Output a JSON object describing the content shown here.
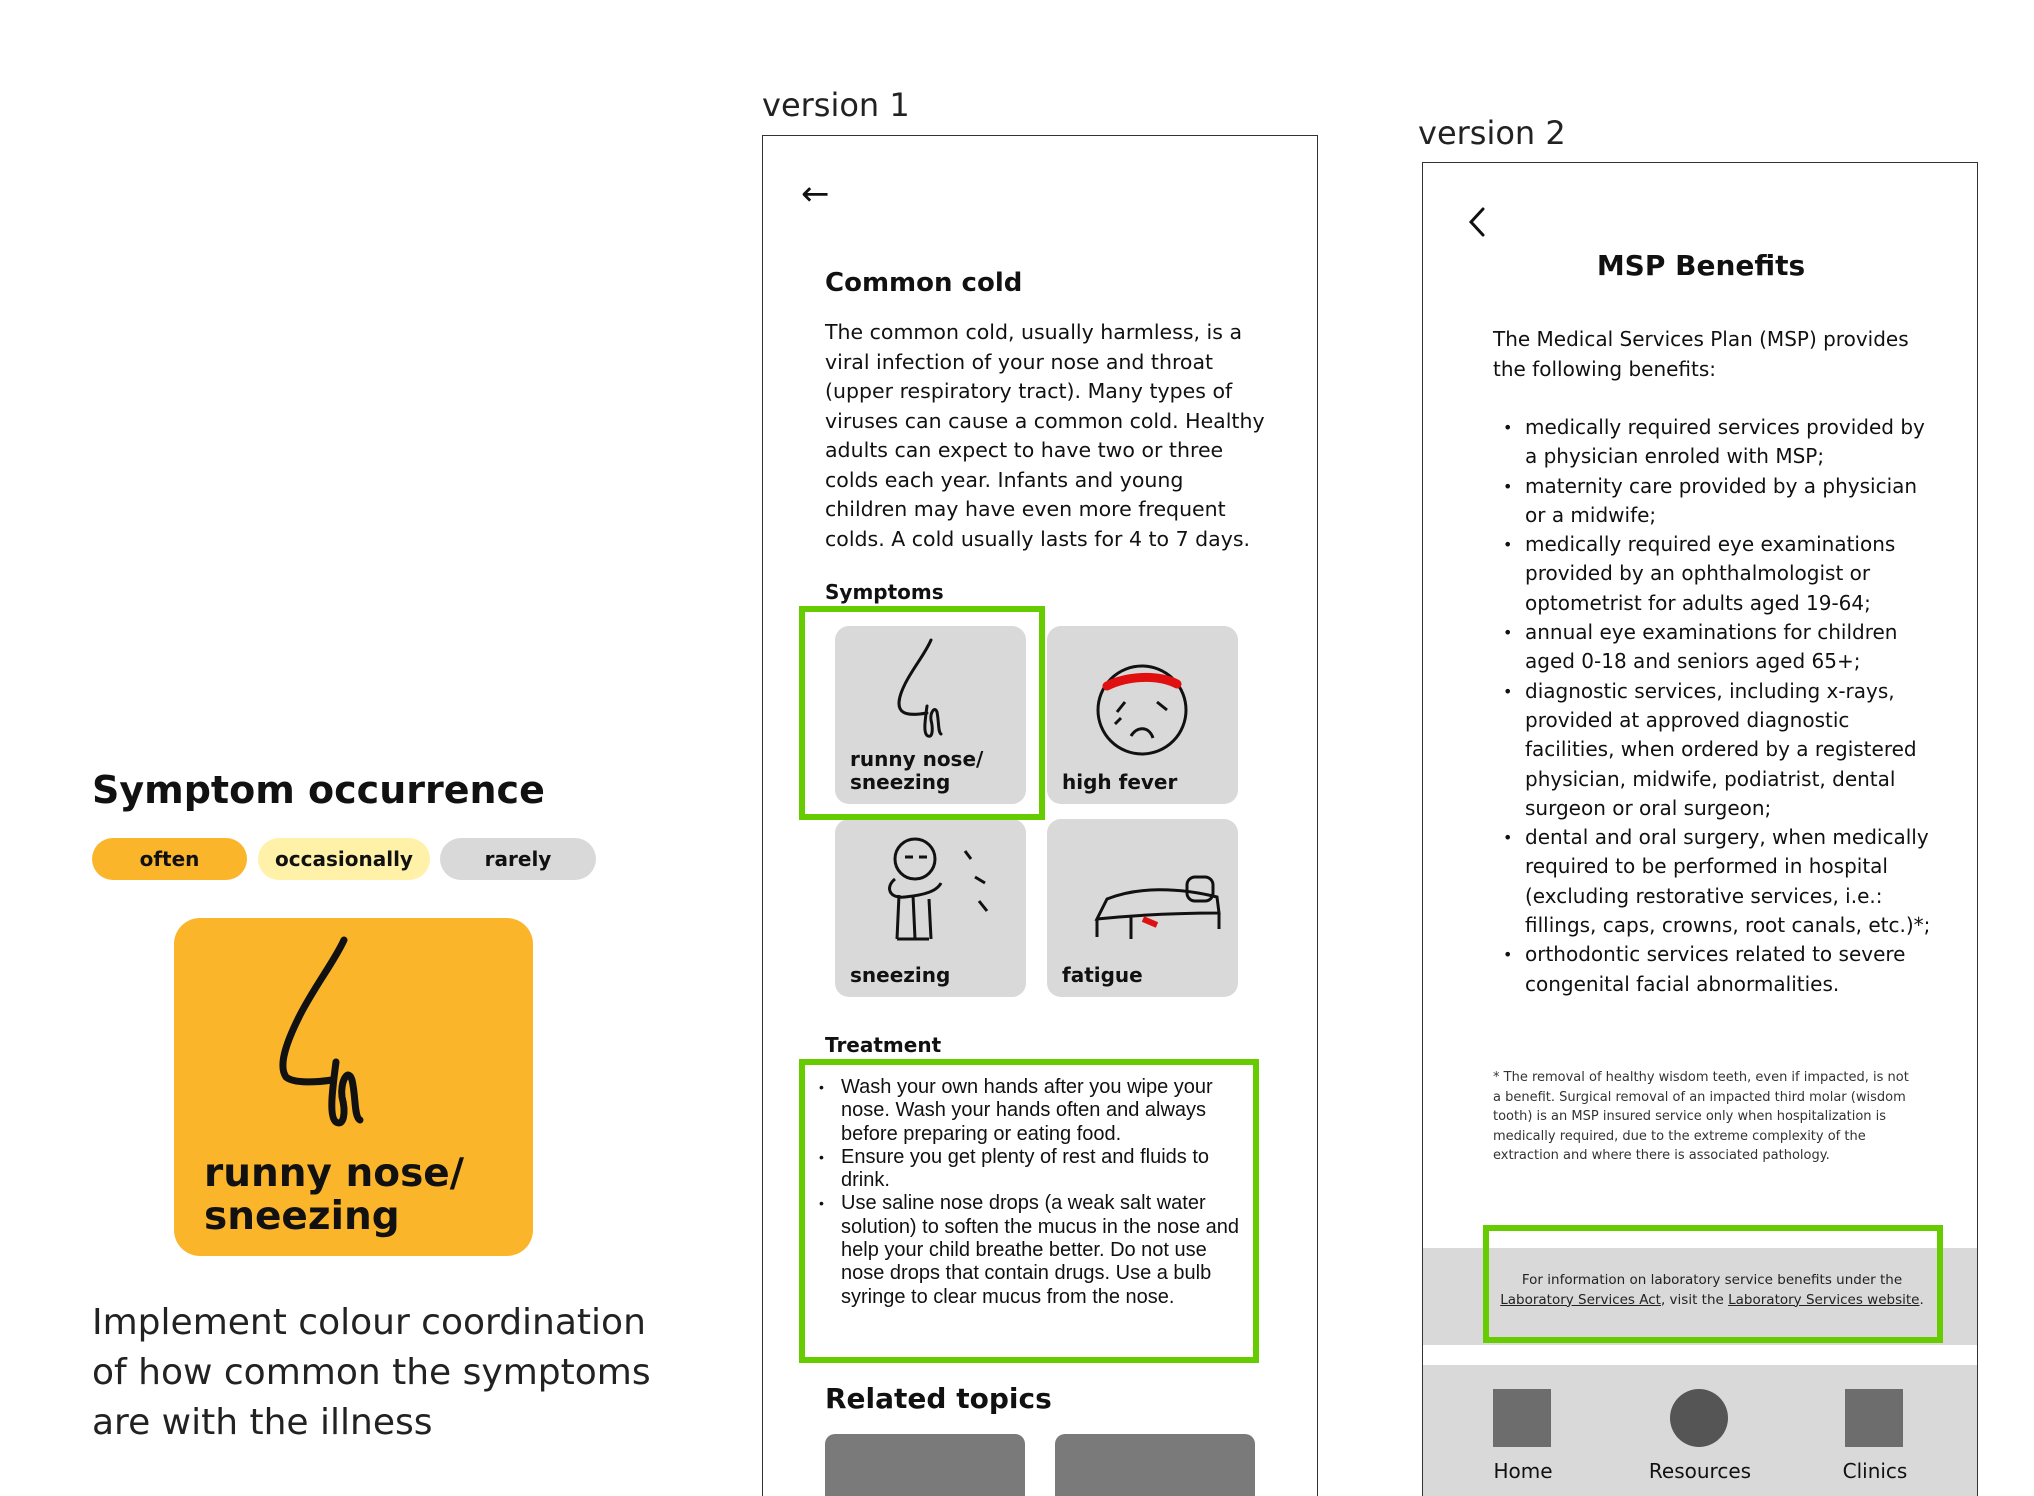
{
  "colors": {
    "often": "#fbb52b",
    "occasionally": "#fff1a8",
    "rarely": "#d9d9d9",
    "highlight_green": "#66cc00",
    "card_grey": "#d9d9d9"
  },
  "annotation": {
    "title": "Symptom occurrence",
    "legend": [
      "often",
      "occasionally",
      "rarely"
    ],
    "example_card_label": "runny nose/\nsneezing",
    "note": "Implement colour coordination of how common the symptoms are with the illness"
  },
  "version1": {
    "label": "version 1",
    "back_icon": "arrow-left-icon",
    "title": "Common cold",
    "description": "The common cold, usually harmless, is a viral infection of your nose and throat (upper respiratory tract). Many types of viruses can cause a common cold. Healthy adults can expect to have two or three colds each year. Infants and young children may have even more frequent colds. A cold usually lasts for 4 to 7 days.",
    "symptoms_heading": "Symptoms",
    "symptoms": [
      {
        "label": "runny nose/\nsneezing",
        "icon": "nose-icon"
      },
      {
        "label": "high fever",
        "icon": "fever-face-icon"
      },
      {
        "label": "sneezing",
        "icon": "sneezing-person-icon"
      },
      {
        "label": "fatigue",
        "icon": "bed-icon"
      }
    ],
    "treatment_heading": "Treatment",
    "treatment": [
      "Wash your own hands after you wipe your nose. Wash your hands often and always before preparing or eating food.",
      "Ensure you get plenty of rest and fluids to drink.",
      "Use saline nose drops (a weak salt water solution) to soften the mucus in the nose and help your child breathe better. Do not use nose drops that contain drugs. Use a bulb syringe to clear mucus from the nose."
    ],
    "related_heading": "Related topics"
  },
  "version2": {
    "label": "version 2",
    "back_icon": "chevron-left-icon",
    "title": "MSP Benefits",
    "intro": "The Medical Services Plan (MSP) provides the following benefits:",
    "benefits": [
      "medically required services provided by a physician enroled with MSP;",
      "maternity care provided by a physician or a midwife;",
      "medically required eye examinations provided by an ophthalmologist or optometrist for adults aged 19-64;",
      "annual eye examinations for children aged 0-18 and seniors aged 65+;",
      "diagnostic services, including x-rays, provided at approved diagnostic facilities, when ordered by a registered physician, midwife, podiatrist, dental surgeon or oral surgeon;",
      "dental and oral surgery, when medically required to be performed in hospital (excluding restorative services, i.e.: fillings, caps, crowns, root canals, etc.)*;",
      "orthodontic services related to severe congenital facial abnormalities."
    ],
    "footnote": "* The removal of healthy wisdom teeth, even if impacted, is not a benefit. Surgical removal of an impacted third molar (wisdom tooth) is an MSP insured service only when hospitalization is medically required, due to the extreme complexity of the extraction and where there is associated pathology.",
    "lab_info": {
      "prefix": "For information on laboratory service benefits under the",
      "link1": "Laboratory Services Act",
      "middle": ", visit the",
      "link2": "Laboratory Services website",
      "suffix": "."
    },
    "nav": [
      {
        "label": "Home",
        "icon": "home-icon"
      },
      {
        "label": "Resources",
        "icon": "resources-icon"
      },
      {
        "label": "Clinics",
        "icon": "clinics-icon"
      }
    ]
  }
}
